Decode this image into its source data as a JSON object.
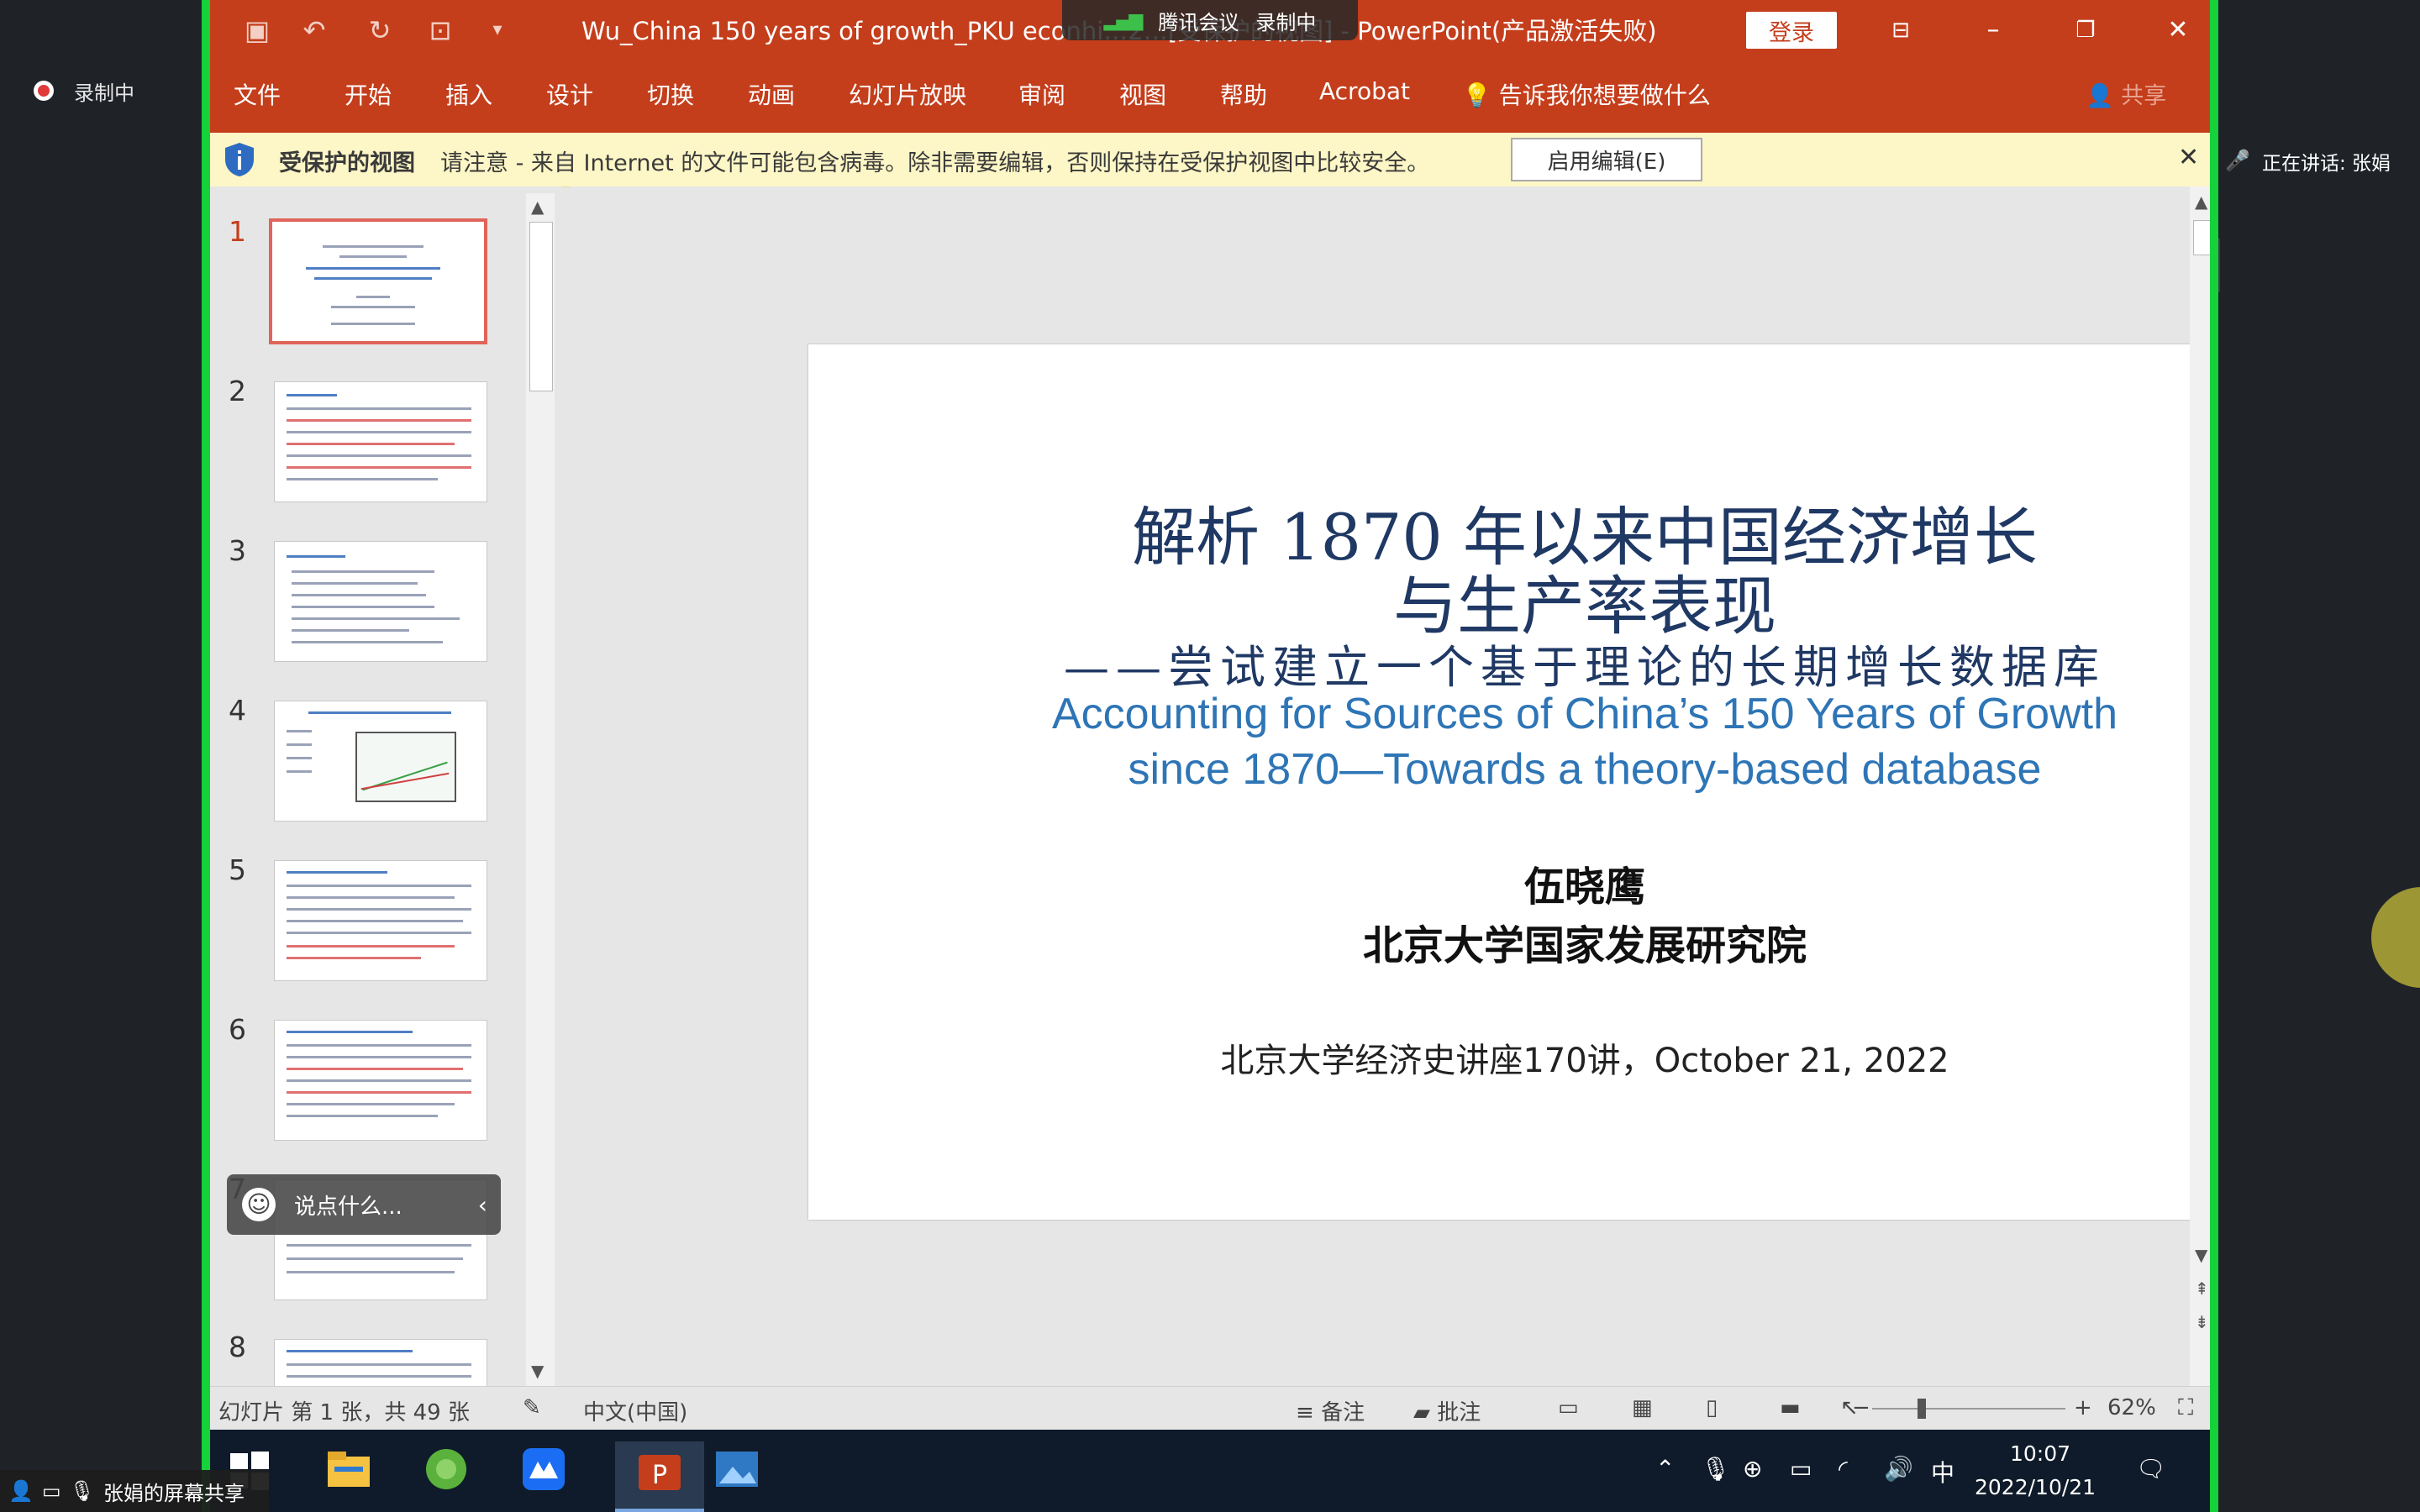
{
  "meeting": {
    "recording_status": "录制中",
    "app_name": "腾讯会议",
    "recording_badge": "录制中",
    "speaking_label": "正在讲话: 张娟",
    "screen_share_label": "张娟的屏幕共享"
  },
  "window": {
    "title": "Wu_China 150 years of growth_PKU econhi…2…[受保护的视图] - PowerPoint(产品激活失败)",
    "login_label": "登录",
    "ribbon_tabs": [
      "文件",
      "开始",
      "插入",
      "设计",
      "切换",
      "动画",
      "幻灯片放映",
      "审阅",
      "视图",
      "帮助",
      "Acrobat"
    ],
    "tell_me": "告诉我你想要做什么",
    "share": "共享"
  },
  "protected_view": {
    "title": "受保护的视图",
    "message": "请注意 - 来自 Internet 的文件可能包含病毒。除非需要编辑，否则保持在受保护视图中比较安全。",
    "enable_button": "启用编辑(E)"
  },
  "thumbnails": [
    "1",
    "2",
    "3",
    "4",
    "5",
    "6",
    "7",
    "8"
  ],
  "comment_prompt": "说点什么...",
  "slide": {
    "title_line1": "解析 1870 年以来中国经济增长",
    "title_line2": "与生产率表现",
    "subtitle_cn": "——尝试建立一个基于理论的长期增长数据库",
    "title_en_line1": "Accounting for Sources of China’s 150 Years of Growth",
    "title_en_line2": "since 1870—Towards a theory-based database",
    "author": "伍晓鹰",
    "institution": "北京大学国家发展研究院",
    "event": "北京大学经济史讲座170讲，October 21, 2022"
  },
  "status": {
    "slide_info": "幻灯片 第 1 张，共 49 张",
    "language": "中文(中国)",
    "notes": "备注",
    "comments": "批注",
    "zoom": "62%"
  },
  "taskbar": {
    "time": "10:07",
    "date": "2022/10/21",
    "ime": "中"
  }
}
